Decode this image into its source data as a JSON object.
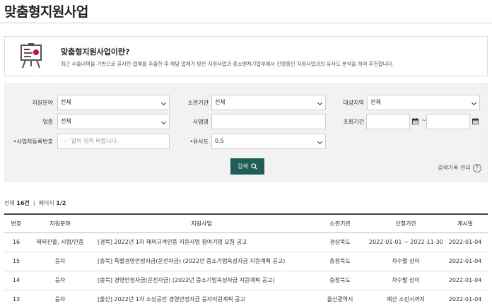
{
  "page": {
    "title": "맞춤형지원사업"
  },
  "intro": {
    "heading": "맞춤형지원사업이란?",
    "description": "최근 수출내역을 기반으로 유사한 업체를 추출한 후 해당 업체가 받은 지원사업과 중소벤처기업부에서 진행중인 지원사업과의 유사도 분석을 하여 추천합니다."
  },
  "filters": {
    "support_field": {
      "label": "지원분야",
      "value": "전체"
    },
    "agency": {
      "label": "소관기관",
      "value": "전체"
    },
    "region": {
      "label": "대상지역",
      "value": "전체"
    },
    "industry": {
      "label": "업종",
      "value": "전체"
    },
    "business_name": {
      "label": "사업명",
      "value": ""
    },
    "period": {
      "label": "조회기간",
      "separator": "~"
    },
    "biz_reg_no": {
      "label": "사업자등록번호",
      "placeholder": "' - ' 없이 입력 바랍니다."
    },
    "similarity": {
      "label": "유사도",
      "value": "0.5"
    },
    "required_mark": "•",
    "search_label": "검색",
    "history_label": "검색기록 관리",
    "help_glyph": "?"
  },
  "results": {
    "total_label": "전체",
    "total_value": "16건",
    "page_label": "페이지",
    "page_value": "1/2"
  },
  "table": {
    "headers": [
      "번호",
      "지원분야",
      "지원사업",
      "소관기관",
      "신청기간",
      "게시일"
    ],
    "rows": [
      {
        "no": "16",
        "field": "해외진출, 시험/인증",
        "title": "[경북] 2022년 1차 해외규격인증 지원사업 참여기업 모집 공고",
        "agency": "경상북도",
        "period": "2022-01-01 ~ 2022-11-30",
        "date": "2022-01-04"
      },
      {
        "no": "15",
        "field": "융자",
        "title": "[충북] 특별경영안정자금(운전자금) (2022년 중소기업육성자금 지원계획 공고)",
        "agency": "충청북도",
        "period": "차수별 상이",
        "date": "2022-01-04"
      },
      {
        "no": "14",
        "field": "융자",
        "title": "[충북] 경영안정자금(운전자금) (2022년 중소기업육성자금 지원계획 공고)",
        "agency": "충청북도",
        "period": "차수별 상이",
        "date": "2022-01-04"
      },
      {
        "no": "13",
        "field": "융자",
        "title": "[울산] 2022년 1차 소상공인 경영안정자금 융자지원계획 공고",
        "agency": "울산광역시",
        "period": "예산 소진시까지",
        "date": "2022-01-04"
      }
    ]
  }
}
